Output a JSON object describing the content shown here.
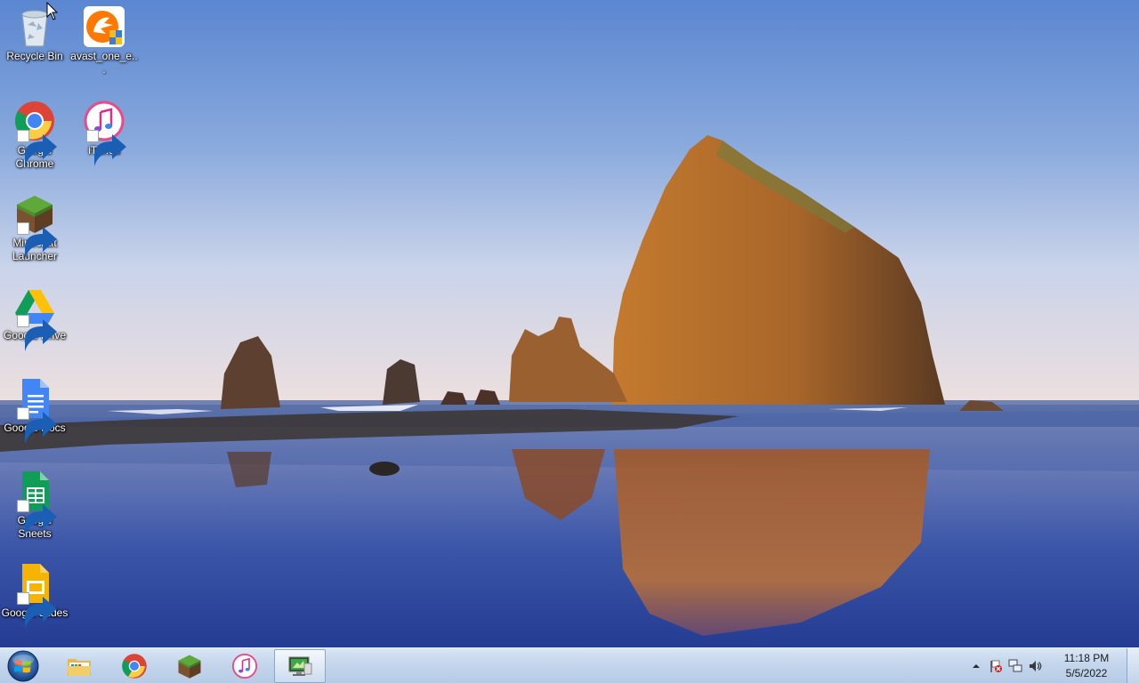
{
  "desktop": {
    "icons": [
      {
        "label": "Recycle Bin"
      },
      {
        "label": "avast_one_e..."
      },
      {
        "label": "Google Chrome"
      },
      {
        "label": "iTunes"
      },
      {
        "label": "Minecraft Launcher"
      },
      {
        "label": "Google Drive"
      },
      {
        "label": "Google Docs"
      },
      {
        "label": "Google Sheets"
      },
      {
        "label": "Google Slides"
      }
    ]
  },
  "taskbar": {
    "pinned": [
      {
        "icon": "file-explorer-icon"
      },
      {
        "icon": "chrome-icon"
      },
      {
        "icon": "minecraft-icon"
      },
      {
        "icon": "itunes-icon"
      },
      {
        "icon": "remote-desktop-icon",
        "active": true
      }
    ],
    "tray": {
      "icons": [
        "show-hidden-icons-arrow",
        "action-center-flag-icon",
        "network-icon",
        "volume-icon"
      ],
      "time": "11:18 PM",
      "date": "5/5/2022"
    }
  },
  "colors": {
    "taskbar": "#c4d6ec",
    "sky_top": "#5a86d0",
    "water": "#2d4aa0",
    "rock": "#b8702a"
  }
}
